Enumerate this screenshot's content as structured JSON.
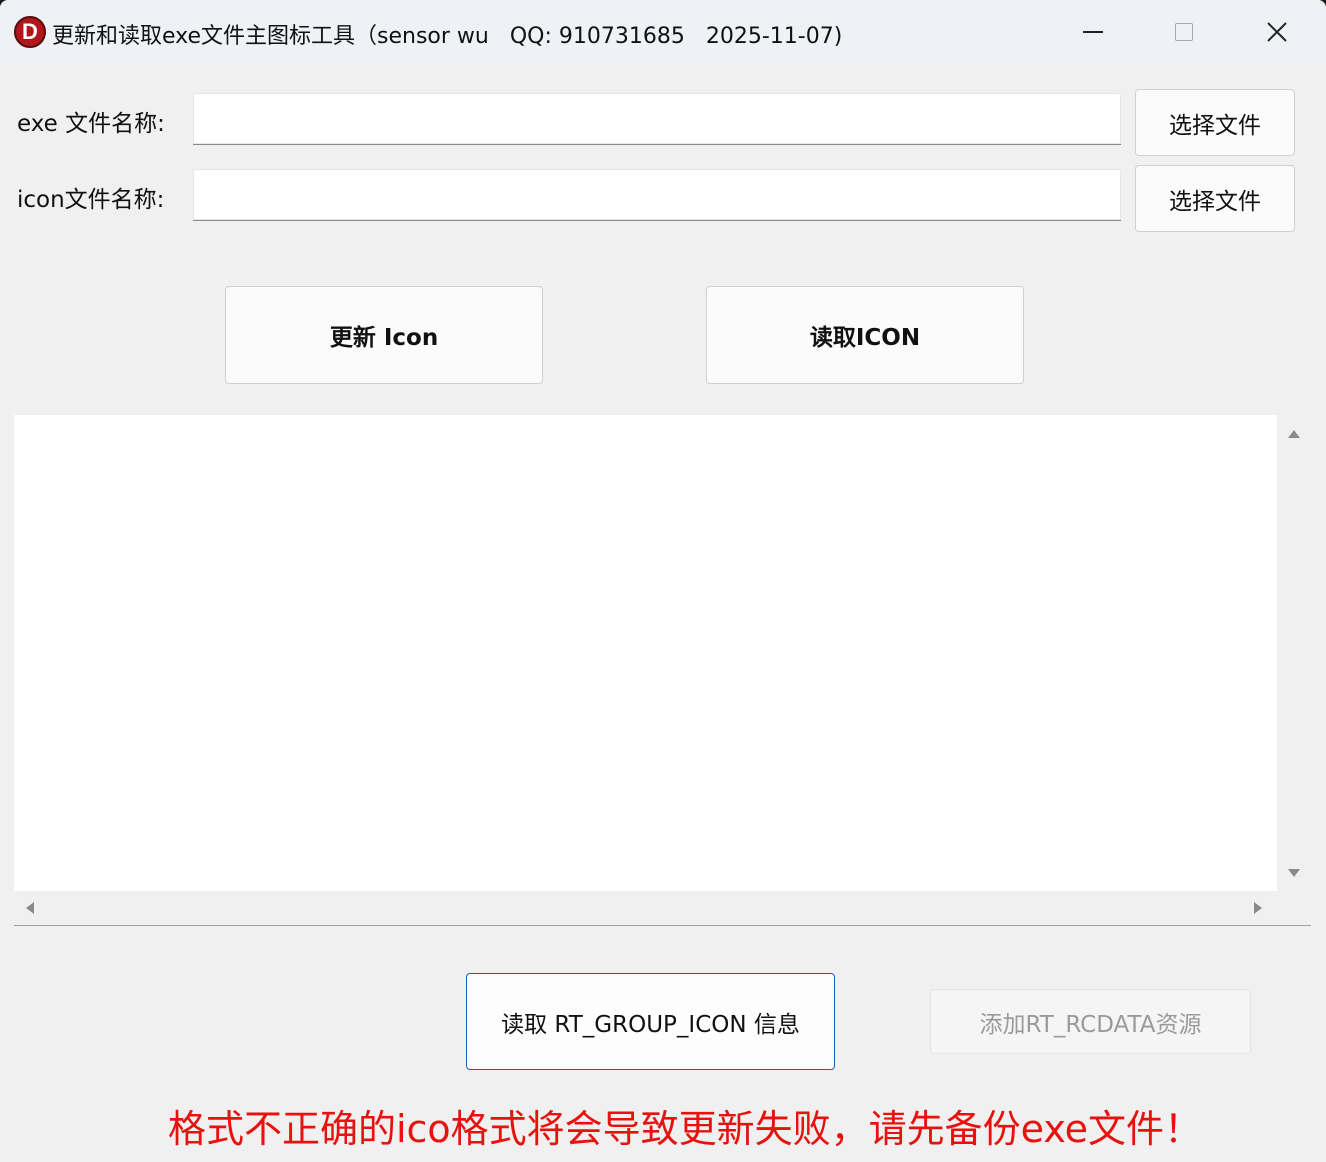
{
  "window": {
    "app_icon_letter": "D",
    "title": "更新和读取exe文件主图标工具（sensor wu   QQ: 910731685   2025-11-07)"
  },
  "form": {
    "exe_label": "exe 文件名称:",
    "exe_value": "",
    "exe_browse_label": "选择文件",
    "icon_label": "icon文件名称:",
    "icon_value": "",
    "icon_browse_label": "选择文件"
  },
  "actions": {
    "update_icon_label": "更新 Icon",
    "read_icon_label": "读取ICON",
    "read_group_icon_label": "读取 RT_GROUP_ICON 信息",
    "add_rcdata_label": "添加RT_RCDATA资源"
  },
  "log": {
    "content": ""
  },
  "warning": {
    "text": "格式不正确的ico格式将会导致更新失败，请先备份exe文件！",
    "color": "#e8110e"
  },
  "icons": {
    "app": "app-logo-icon",
    "minimize": "minimize-icon",
    "maximize": "maximize-icon",
    "close": "close-icon"
  }
}
